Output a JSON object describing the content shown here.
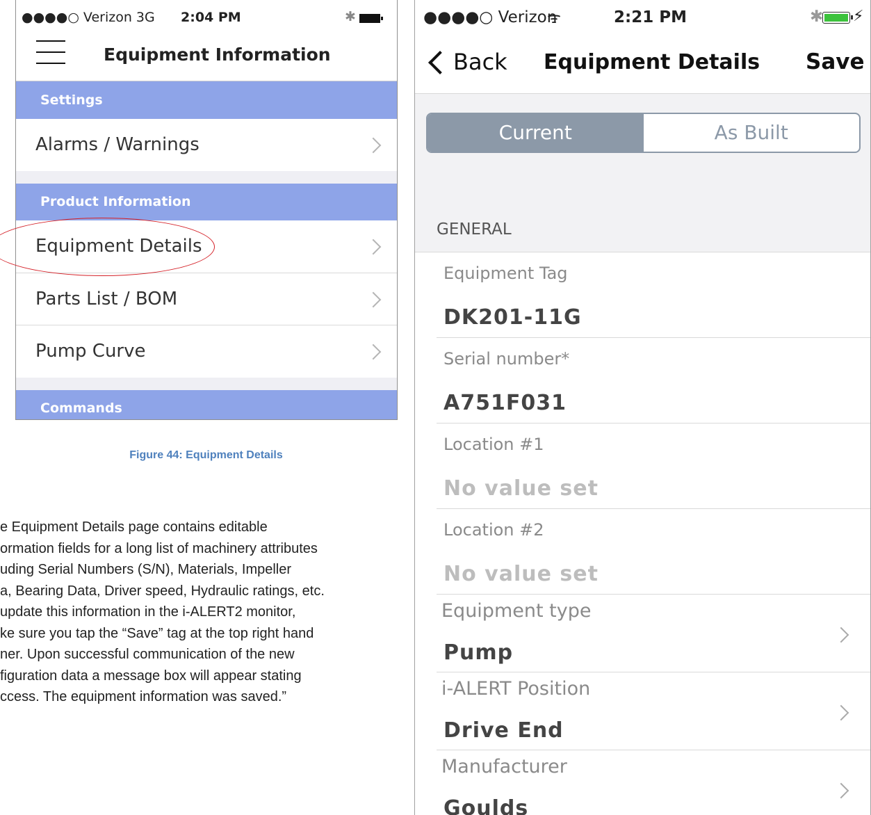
{
  "left_phone": {
    "status": {
      "carrier": "●●●●○ Verizon  3G",
      "time": "2:04 PM",
      "bluetooth": "✱"
    },
    "nav_title": "Equipment Information",
    "sections": [
      {
        "header": "Settings",
        "items": [
          "Alarms / Warnings"
        ]
      },
      {
        "header": "Product Information",
        "items": [
          "Equipment Details",
          "Parts List / BOM",
          "Pump Curve"
        ]
      },
      {
        "header": "Commands",
        "items": []
      }
    ],
    "highlighted_item": "Equipment Details",
    "highlight_color": "#d41f26",
    "section_color": "#8ea4e8"
  },
  "caption": "Figure 44: Equipment Details",
  "body_text_lines": [
    "e Equipment Details page contains editable",
    "ormation fields for a long list of machinery attributes",
    "uding Serial Numbers (S/N), Materials, Impeller",
    "a, Bearing Data, Driver speed, Hydraulic ratings, etc.",
    "update this information in the i-ALERT2 monitor,",
    "ke sure you tap the “Save” tag at the top right hand",
    "ner. Upon successful communication of the new",
    "figuration data a message box will appear stating",
    "ccess. The equipment information was saved.”"
  ],
  "right_phone": {
    "status": {
      "carrier": "●●●●○ Verizon",
      "wifi": "ᯤ",
      "time": "2:21 PM",
      "bluetooth": "✱",
      "charging": "⚡"
    },
    "back_label": "Back",
    "title": "Equipment Details",
    "save_label": "Save",
    "segments": [
      "Current",
      "As Built"
    ],
    "selected_segment": "Current",
    "section_label": "GENERAL",
    "fields": [
      {
        "label": "Equipment Tag",
        "value": "DK201-11G",
        "set": true,
        "has_chevron": false
      },
      {
        "label": "Serial number*",
        "value": "A751F031",
        "set": true,
        "has_chevron": false
      },
      {
        "label": "Location #1",
        "value": "No value set",
        "set": false,
        "has_chevron": false
      },
      {
        "label": "Location #2",
        "value": "No value set",
        "set": false,
        "has_chevron": false
      },
      {
        "label": "Equipment type",
        "value": "Pump",
        "set": true,
        "has_chevron": true
      },
      {
        "label": "i-ALERT Position",
        "value": "Drive End",
        "set": true,
        "has_chevron": true
      },
      {
        "label": "Manufacturer",
        "value": "Goulds",
        "set": true,
        "has_chevron": true
      }
    ],
    "segment_color": "#8c99a8",
    "battery_color": "#3cc23c"
  }
}
